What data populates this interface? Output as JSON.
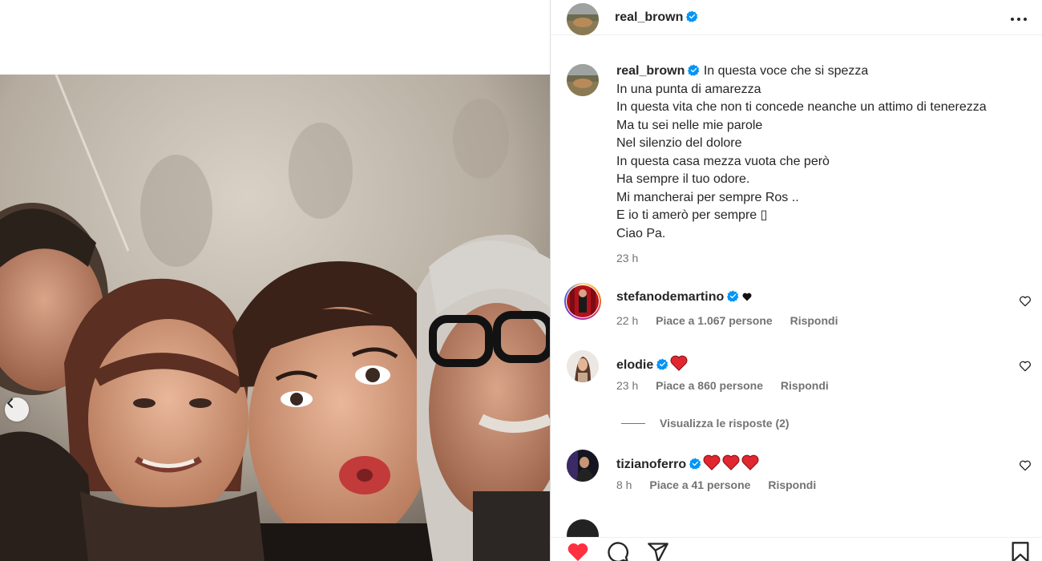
{
  "post": {
    "username": "real_brown",
    "caption_lines": [
      "In questa voce che si spezza",
      "In una punta di amarezza",
      "In questa vita che non ti concede neanche un attimo di tenerezza",
      "Ma tu sei nelle mie parole",
      "Nel silenzio del dolore",
      "In questa casa mezza vuota che però",
      "Ha sempre il tuo odore.",
      "Mi mancherai per sempre Ros ..",
      "E io ti amerò per sempre ▯",
      "Ciao Pa."
    ],
    "caption_time": "23 h"
  },
  "comments": [
    {
      "username": "stefanodemartino",
      "text": "",
      "time": "22 h",
      "likes": "Piace a 1.067 persone",
      "reply": "Rispondi"
    },
    {
      "username": "elodie",
      "text": "",
      "time": "23 h",
      "likes": "Piace a 860 persone",
      "reply": "Rispondi"
    },
    {
      "username": "tizianoferro",
      "text": "",
      "time": "8 h",
      "likes": "Piace a 41 persone",
      "reply": "Rispondi"
    }
  ],
  "view_replies": "Visualizza le risposte (2)",
  "icons": {
    "verified": "verified-badge-icon",
    "more": "more-options-icon",
    "like": "heart-icon",
    "comment": "comment-icon",
    "share": "share-icon",
    "save": "bookmark-icon",
    "prev": "chevron-left-icon"
  },
  "colors": {
    "verified": "#0095f6",
    "liked": "#ff3040",
    "muted": "#737373"
  }
}
